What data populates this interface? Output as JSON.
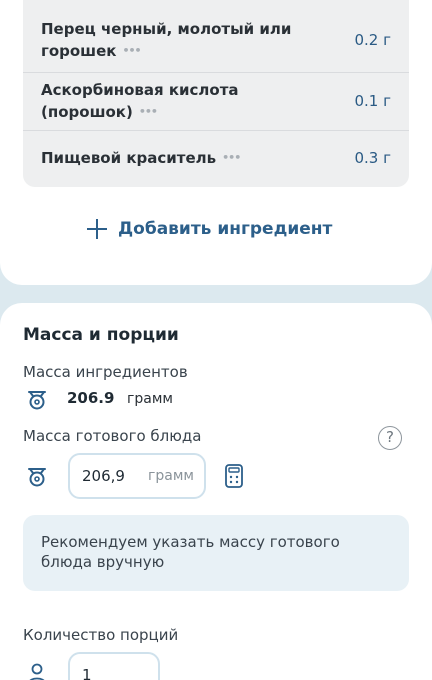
{
  "ingredients": [
    {
      "name": "Перец черный, молотый или горошек",
      "amount": "0.2 г"
    },
    {
      "name": "Аскорбиновая кислота (порошок)",
      "amount": "0.1 г"
    },
    {
      "name": "Пищевой краситель",
      "amount": "0.3 г"
    }
  ],
  "more_glyph": "•••",
  "add_ingredient_label": "Добавить ингредиент",
  "mass_section": {
    "title": "Масса и порции",
    "ingredients_mass_label": "Масса ингредиентов",
    "ingredients_mass_value": "206.9",
    "ingredients_mass_unit": "грамм",
    "ready_mass_label": "Масса готового блюда",
    "ready_mass_value": "206,9",
    "ready_mass_unit": "грамм",
    "help_glyph": "?",
    "hint": "Рекомендуем указать массу готового блюда вручную",
    "portions_label": "Количество порций",
    "portions_value": "1"
  },
  "colors": {
    "accent": "#2c5f8a",
    "background": "#dce9ef",
    "hint_bg": "#e8f1f6"
  },
  "icons": [
    "scale-icon",
    "help-icon",
    "calculator-icon",
    "person-icon",
    "plus-icon",
    "more-dots-icon"
  ]
}
